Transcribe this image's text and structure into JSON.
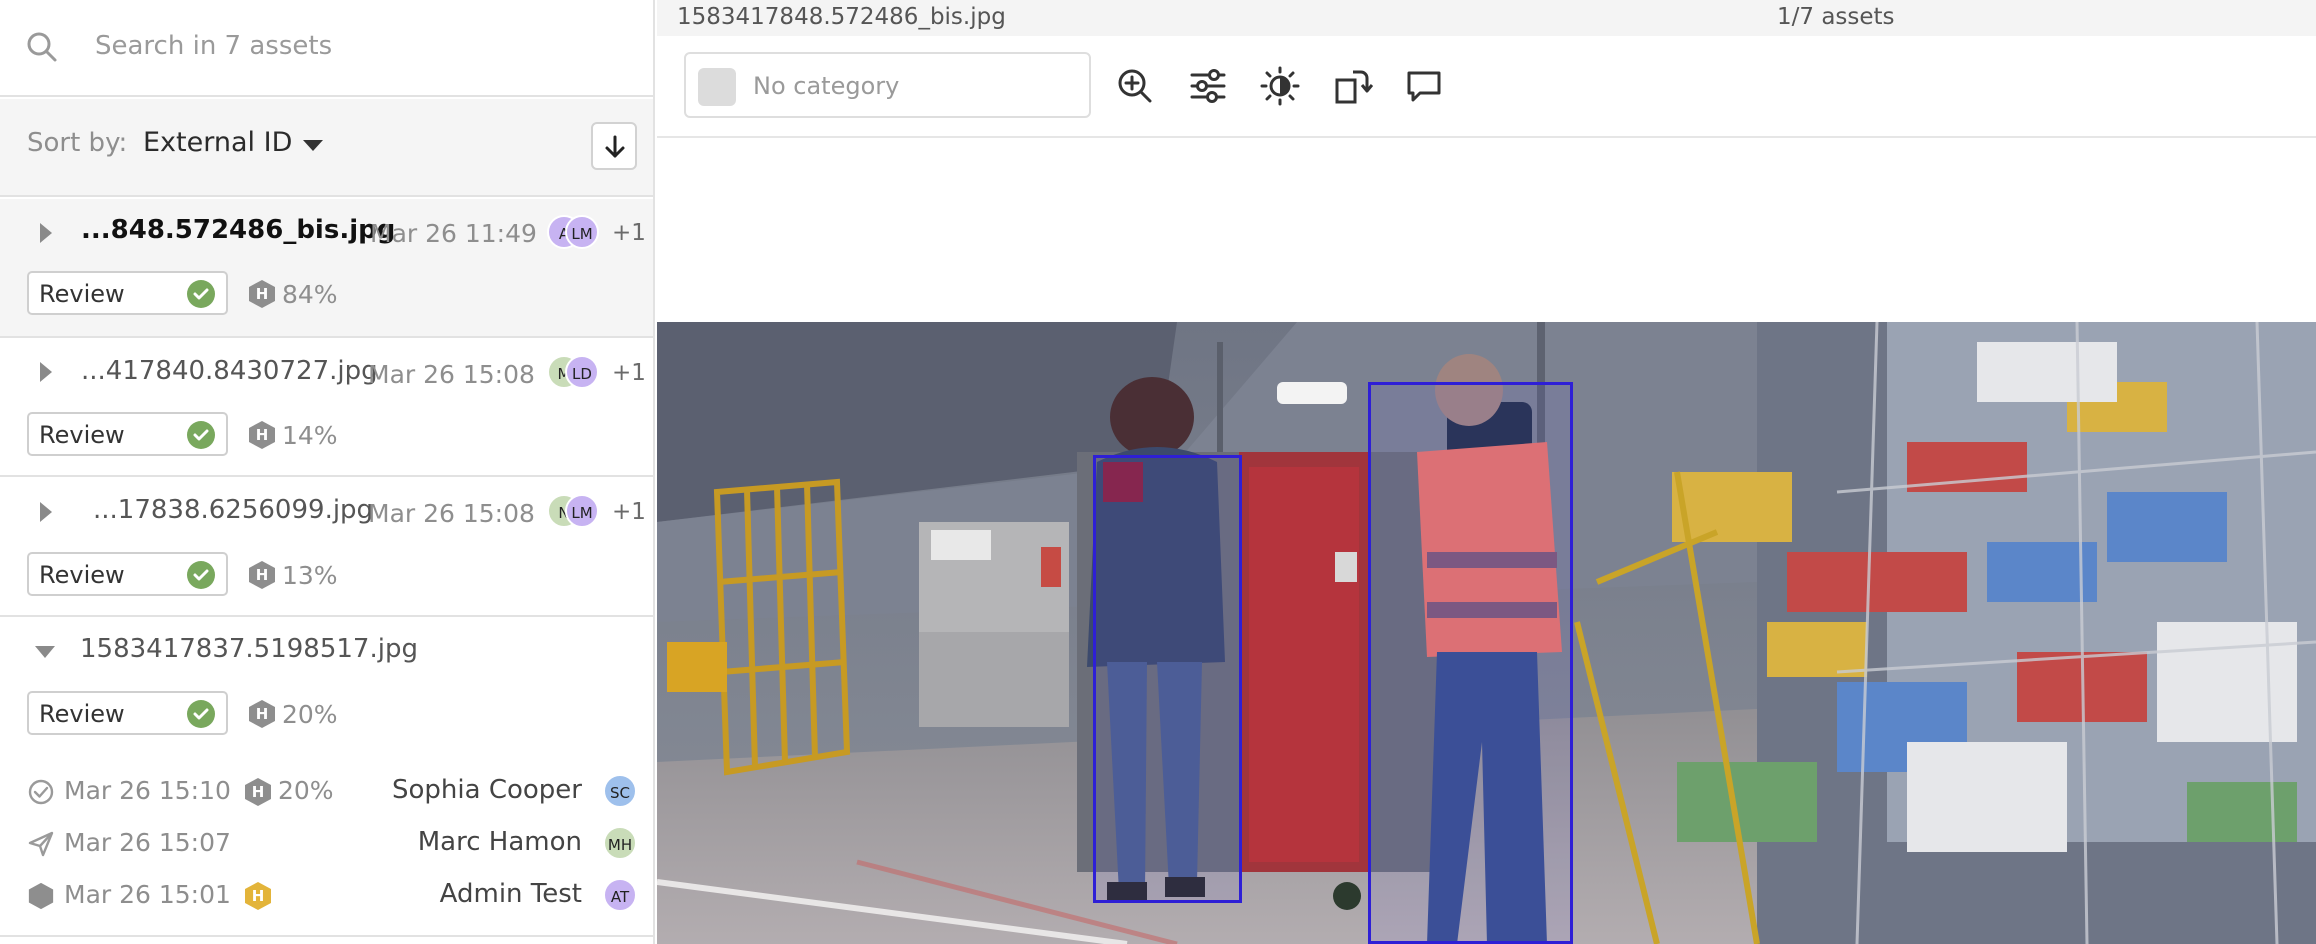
{
  "search": {
    "placeholder": "Search in 7 assets",
    "value": ""
  },
  "sort": {
    "label": "Sort by:",
    "value": "External ID",
    "direction": "descending"
  },
  "assets": [
    {
      "name": "...848.572486_bis.jpg",
      "date": "Mar 26 11:49",
      "avatars": [
        "A",
        "LM"
      ],
      "extra": "+1",
      "status": "Review",
      "hex_letter": "H",
      "percent": "84%",
      "selected": true,
      "expanded": false
    },
    {
      "name": "...417840.8430727.jpg",
      "date": "Mar 26 15:08",
      "avatars": [
        "M",
        "LD"
      ],
      "extra": "+1",
      "status": "Review",
      "hex_letter": "H",
      "percent": "14%",
      "selected": false,
      "expanded": false
    },
    {
      "name": "...17838.6256099.jpg",
      "date": "Mar 26 15:08",
      "avatars": [
        "N",
        "LM"
      ],
      "extra": "+1",
      "status": "Review",
      "hex_letter": "H",
      "percent": "13%",
      "selected": false,
      "expanded": false
    },
    {
      "name": "1583417837.5198517.jpg",
      "status": "Review",
      "hex_letter": "H",
      "percent": "20%",
      "selected": false,
      "expanded": true,
      "history": [
        {
          "icon": "check-circle-icon",
          "date": "Mar 26 15:10",
          "hex_letter": "H",
          "percent": "20%",
          "user": "Sophia Cooper",
          "initials": "SC"
        },
        {
          "icon": "send-icon",
          "date": "Mar 26 15:07",
          "user": "Marc Hamon",
          "initials": "MH"
        },
        {
          "icon": "hex-icon",
          "date": "Mar 26 15:01",
          "hex_letter": "H",
          "user": "Admin Test",
          "initials": "AT"
        }
      ]
    }
  ],
  "viewer": {
    "file_title": "1583417848.572486_bis.jpg",
    "counter": "1/7 assets",
    "category_placeholder": "No category",
    "tools": [
      "zoom-in-icon",
      "adjust-sliders-icon",
      "brightness-icon",
      "rotate-icon",
      "comment-icon"
    ]
  },
  "colors": {
    "accent_box": "#2e1fd6",
    "review_check": "#79a85d",
    "hex_gray": "#8e8e8e",
    "hex_yellow": "#e3b43a",
    "avatar_purple": "#c7b3f2",
    "avatar_green": "#c9dcb8",
    "avatar_blue": "#9ec0ec"
  }
}
